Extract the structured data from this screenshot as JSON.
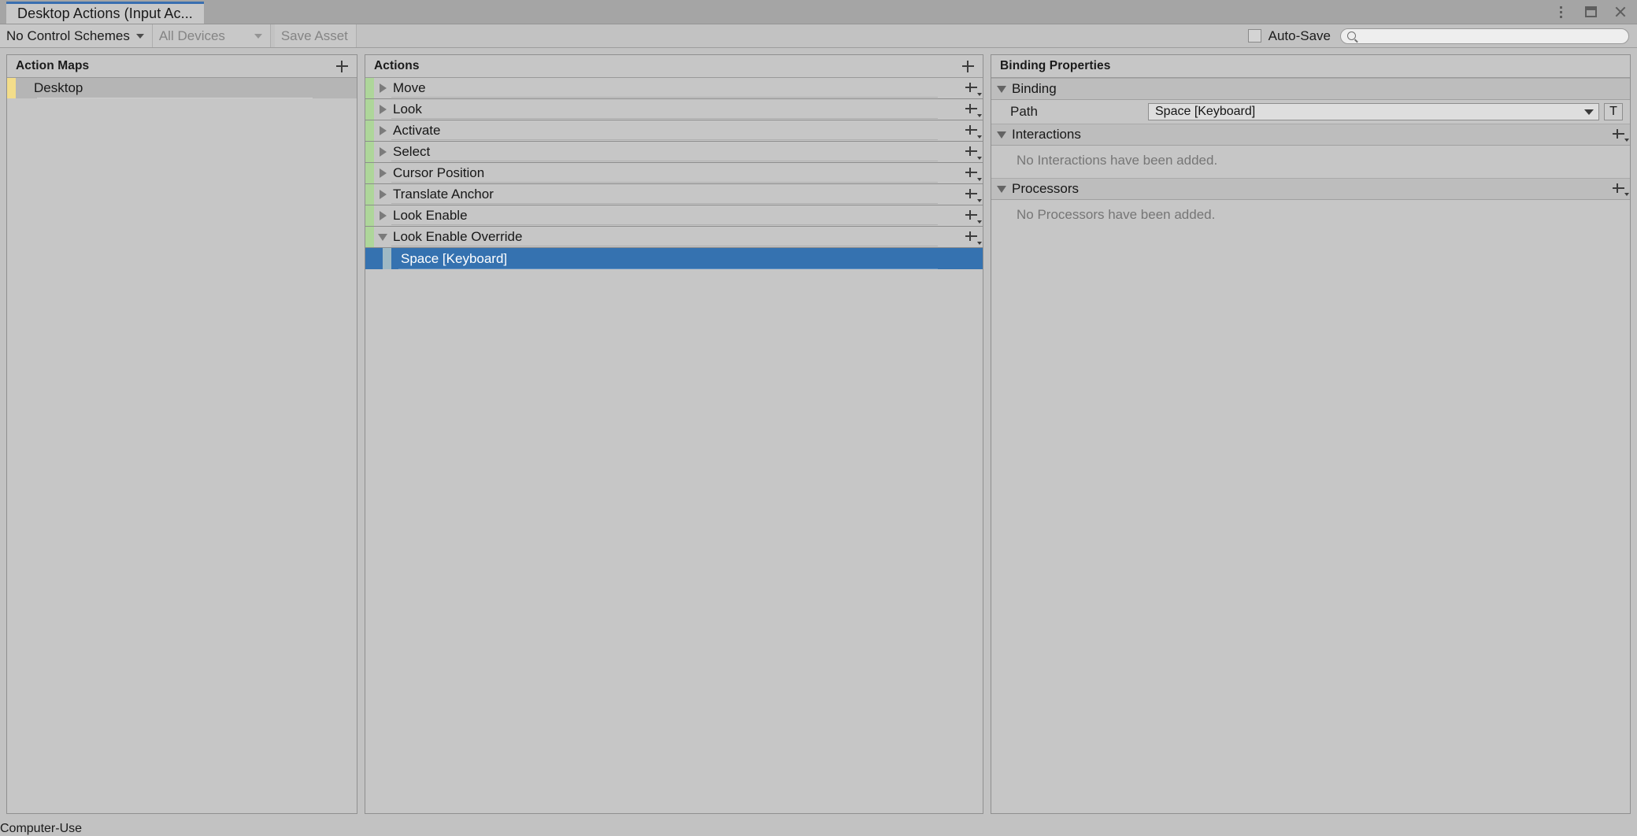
{
  "window": {
    "tab_title": "Desktop Actions (Input Ac...",
    "controls": {
      "menu": "kebab-menu-icon",
      "maximize": "maximize-icon",
      "close": "close-icon"
    }
  },
  "toolbar": {
    "control_schemes_label": "No Control Schemes",
    "devices_label": "All Devices",
    "save_asset_label": "Save Asset",
    "autosave_label": "Auto-Save",
    "autosave_checked": false,
    "search_value": "",
    "search_placeholder": ""
  },
  "action_maps": {
    "title": "Action Maps",
    "add_label": "+",
    "items": [
      {
        "label": "Desktop",
        "selected": true,
        "stripe": "#f3dd8a"
      }
    ]
  },
  "actions": {
    "title": "Actions",
    "add_label": "+",
    "items": [
      {
        "label": "Move",
        "expanded": false,
        "stripe": "#aed69a"
      },
      {
        "label": "Look",
        "expanded": false,
        "stripe": "#aed69a"
      },
      {
        "label": "Activate",
        "expanded": false,
        "stripe": "#aed69a"
      },
      {
        "label": "Select",
        "expanded": false,
        "stripe": "#aed69a"
      },
      {
        "label": "Cursor Position",
        "expanded": false,
        "stripe": "#aed69a"
      },
      {
        "label": "Translate Anchor",
        "expanded": false,
        "stripe": "#aed69a"
      },
      {
        "label": "Look Enable",
        "expanded": false,
        "stripe": "#aed69a"
      },
      {
        "label": "Look Enable Override",
        "expanded": true,
        "stripe": "#aed69a",
        "bindings": [
          {
            "label": "Space [Keyboard]",
            "selected": true,
            "stripe": "#9fb9c4"
          }
        ]
      }
    ]
  },
  "binding_properties": {
    "title": "Binding Properties",
    "sections": {
      "binding": {
        "title": "Binding",
        "expanded": true,
        "path_label": "Path",
        "path_value": "Space [Keyboard]",
        "path_button_label": "T"
      },
      "interactions": {
        "title": "Interactions",
        "expanded": true,
        "empty_text": "No Interactions have been added.",
        "add_label": "+"
      },
      "processors": {
        "title": "Processors",
        "expanded": true,
        "empty_text": "No Processors have been added.",
        "add_label": "+"
      }
    }
  },
  "colors": {
    "selection_blue": "#3572b0",
    "tab_accent": "#3a6fb0",
    "action_map_stripe": "#f3dd8a",
    "action_stripe": "#aed69a",
    "binding_stripe": "#9fb9c4",
    "window_bg": "#c2c2c2"
  }
}
